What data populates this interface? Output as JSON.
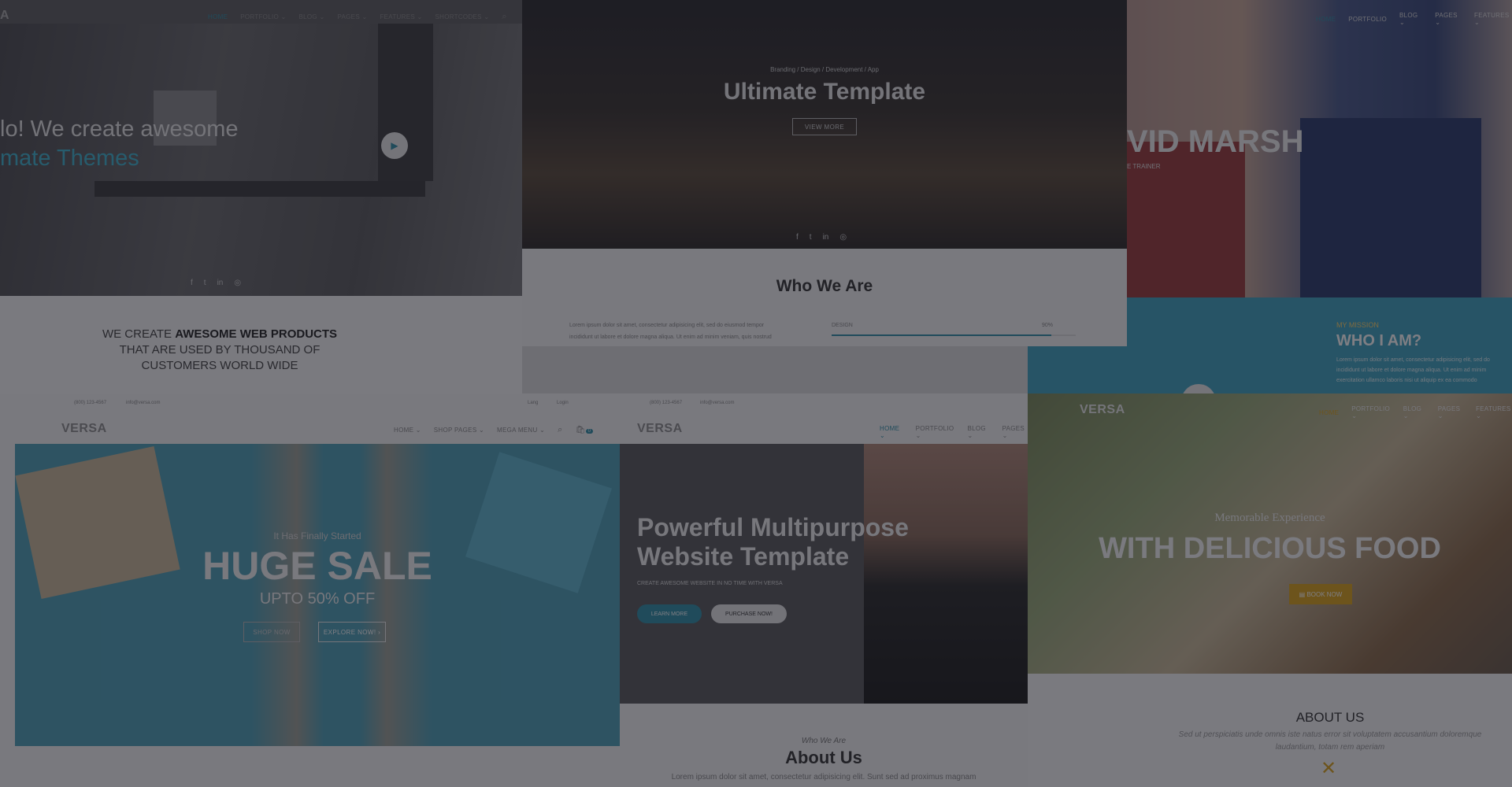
{
  "panel_a": {
    "logo": "A",
    "nav": [
      "HOME",
      "PORTFOLIO ⌄",
      "BLOG ⌄",
      "PAGES ⌄",
      "FEATURES ⌄",
      "SHORTCODES ⌄"
    ],
    "headline_1": "lo! We create awesome",
    "headline_2": "mate Themes",
    "social": [
      "f",
      "t",
      "in",
      "◎"
    ]
  },
  "panel_b": {
    "eyebrow": "Branding / Design / Development / App",
    "title": "Ultimate Template",
    "button": "VIEW MORE",
    "social": [
      "f",
      "t",
      "in",
      "◎"
    ],
    "section_title": "Who We Are",
    "paragraph_1": "Lorem ipsum dolor sit amet, consectetur adipisicing elit, sed do eiusmod tempor",
    "paragraph_2": "incididunt ut labore et dolore magna aliqua. Ut enim ad minim veniam, quis nostrud",
    "progress_label": "DESIGN",
    "progress_value": "90%"
  },
  "panel_c": {
    "nav": [
      "HOME",
      "PORTFOLIO",
      "BLOG ⌄",
      "PAGES ⌄",
      "FEATURES ⌄"
    ],
    "name": "VID MARSH",
    "subtitle": "E TRAINER",
    "mission_eyebrow": "MY MISSION",
    "mission_title": "WHO I AM?",
    "mission_text_1": "Lorem ipsum dolor sit amet, consectetur adipisicing elit, sed do",
    "mission_text_2": "incididunt ut labore et dolore magna aliqua. Ut enim ad minim",
    "mission_text_3": "exercitation ullamco laboris nisi ut aliquip ex ea commodo"
  },
  "panel_d": {
    "lead": "WE CREATE ",
    "lead_bold": "AWESOME WEB PRODUCTS",
    "line_2": "THAT ARE USED BY THOUSAND OF",
    "line_3": "CUSTOMERS WORLD WIDE"
  },
  "panel_e": {
    "topbar_phone": "(800) 123-4567",
    "topbar_email": "info@versa.com",
    "topbar_lang": "Lang",
    "topbar_login": "Login",
    "logo": "VERSA",
    "nav": [
      "HOME ⌄",
      "SHOP PAGES ⌄",
      "MEGA MENU ⌄"
    ],
    "cart_count": "0",
    "eyebrow": "It Has Finally Started",
    "title": "HUGE SALE",
    "subtitle": "UPTO 50% OFF",
    "button_1": "SHOP NOW",
    "button_2": "EXPLORE NOW! ›"
  },
  "panel_f": {
    "topbar_phone": "(800) 123-4567",
    "topbar_email": "info@versa.com",
    "logo": "VERSA",
    "nav": [
      "HOME ⌄",
      "PORTFOLIO ⌄",
      "BLOG ⌄",
      "PAGES ⌄"
    ],
    "title_1": "Powerful Multipurpose",
    "title_2": "Website Template",
    "subtitle": "CREATE AWESOME WEBSITE IN NO TIME WITH VERSA",
    "button_1": "LEARN MORE",
    "button_2": "PURCHASE NOW!",
    "section_eyebrow": "Who We Are",
    "section_title": "About Us",
    "section_text": "Lorem ipsum dolor sit amet, consectetur adipisicing elit. Sunt sed ad proximus magnam"
  },
  "panel_g": {
    "logo": "VERSA",
    "nav": [
      "HOME",
      "PORTFOLIO ⌄",
      "BLOG ⌄",
      "PAGES ⌄",
      "FEATURES ⌄"
    ],
    "eyebrow": "Memorable Experience",
    "title": "WITH DELICIOUS FOOD",
    "button": "▤ BOOK NOW",
    "about_title": "ABOUT US",
    "about_text_1": "Sed ut perspiciatis unde omnis iste natus error sit voluptatem accusantium doloremque",
    "about_text_2": "laudantium, totam rem aperiam"
  },
  "colors": {
    "accent": "#2f8fa6",
    "mission_bg": "#3ea3be",
    "sale_bg": "#4e9fb6",
    "gold": "#d9a21b"
  }
}
